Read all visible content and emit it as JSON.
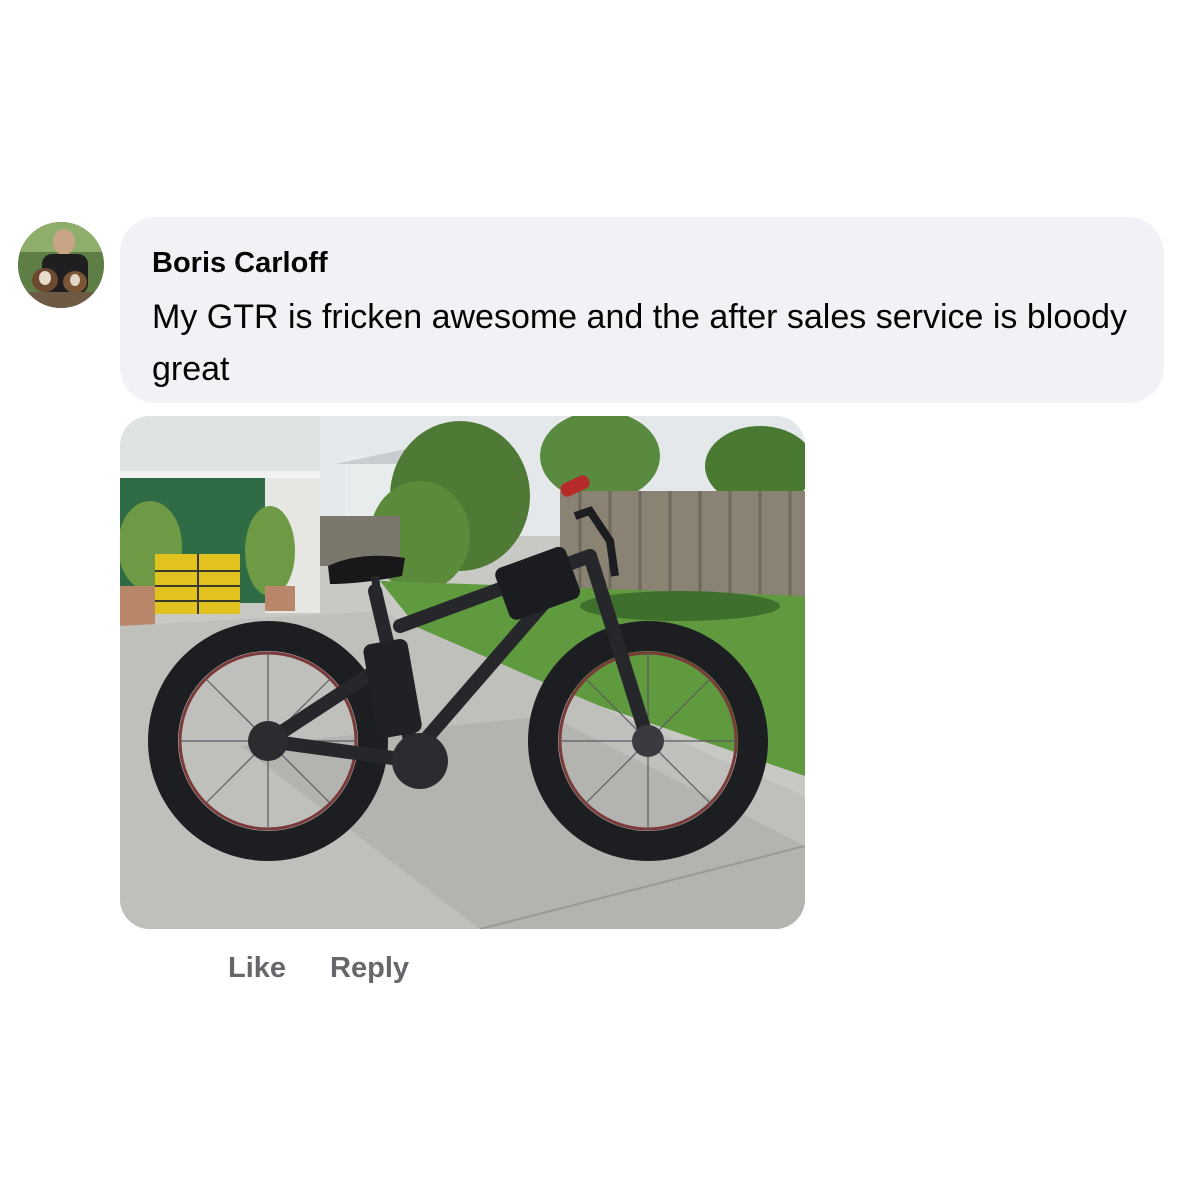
{
  "comment": {
    "author": "Boris Carloff",
    "text": "My GTR is fricken awesome and the after sales service is bloody great",
    "actions": {
      "like_label": "Like",
      "reply_label": "Reply"
    }
  }
}
